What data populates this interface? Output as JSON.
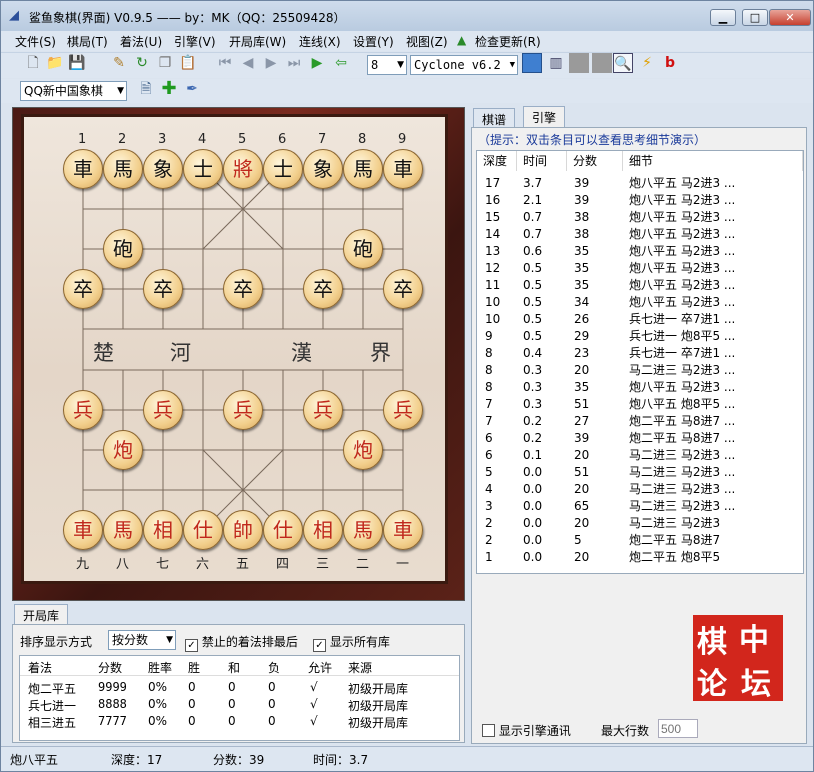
{
  "window": {
    "title": "鲨鱼象棋(界面) V0.9.5  —— by：MK（QQ：25509428）",
    "min": "▁",
    "max": "□",
    "close": "✕"
  },
  "menu": [
    "文件(S)",
    "棋局(T)",
    "着法(U)",
    "引擎(V)",
    "开局库(W)",
    "连线(X)",
    "设置(Y)",
    "视图(Z)",
    "检查更新(R)"
  ],
  "toolbar": {
    "depth_value": "8",
    "engine_value": "Cyclone v6.2",
    "library_value": "QQ新中国象棋"
  },
  "board": {
    "top_files": [
      "1",
      "2",
      "3",
      "4",
      "5",
      "6",
      "7",
      "8",
      "9"
    ],
    "bottom_files": [
      "九",
      "八",
      "七",
      "六",
      "五",
      "四",
      "三",
      "二",
      "一"
    ],
    "river": [
      "楚",
      "河",
      "漢",
      "界"
    ],
    "pieces": [
      "車",
      "馬",
      "象",
      "士",
      "將",
      "士",
      "象",
      "馬",
      "車",
      "砲",
      "砲",
      "卒",
      "卒",
      "卒",
      "卒",
      "卒",
      "兵",
      "兵",
      "兵",
      "兵",
      "兵",
      "炮",
      "炮",
      "車",
      "馬",
      "相",
      "仕",
      "帥",
      "仕",
      "相",
      "馬",
      "車"
    ]
  },
  "opening": {
    "tab": "开局库",
    "sort_label": "排序显示方式",
    "sort_value": "按分数",
    "forbid_label": "禁止的着法排最后",
    "show_all_label": "显示所有库",
    "columns": [
      "着法",
      "分数",
      "胜率",
      "胜",
      "和",
      "负",
      "允许",
      "来源"
    ],
    "rows": [
      [
        "炮二平五",
        "9999",
        "0%",
        "0",
        "0",
        "0",
        "√",
        "初级开局库"
      ],
      [
        "兵七进一",
        "8888",
        "0%",
        "0",
        "0",
        "0",
        "√",
        "初级开局库"
      ],
      [
        "相三进五",
        "7777",
        "0%",
        "0",
        "0",
        "0",
        "√",
        "初级开局库"
      ]
    ]
  },
  "engine": {
    "tabs": [
      "棋谱",
      "引擎"
    ],
    "hint": "（提示：双击条目可以查看思考细节演示）",
    "columns": [
      "深度",
      "时间",
      "分数",
      "细节"
    ],
    "rows": [
      [
        "17",
        "3.7",
        "39",
        "炮八平五 马2进3 ..."
      ],
      [
        "16",
        "2.1",
        "39",
        "炮八平五 马2进3 ..."
      ],
      [
        "15",
        "0.7",
        "38",
        "炮八平五 马2进3 ..."
      ],
      [
        "14",
        "0.7",
        "38",
        "炮八平五 马2进3 ..."
      ],
      [
        "13",
        "0.6",
        "35",
        "炮八平五 马2进3 ..."
      ],
      [
        "12",
        "0.5",
        "35",
        "炮八平五 马2进3 ..."
      ],
      [
        "11",
        "0.5",
        "35",
        "炮八平五 马2进3 ..."
      ],
      [
        "10",
        "0.5",
        "34",
        "炮八平五 马2进3 ..."
      ],
      [
        "10",
        "0.5",
        "26",
        "兵七进一 卒7进1 ..."
      ],
      [
        "9",
        "0.5",
        "29",
        "兵七进一 炮8平5 ..."
      ],
      [
        "8",
        "0.4",
        "23",
        "兵七进一 卒7进1 ..."
      ],
      [
        "8",
        "0.3",
        "20",
        "马二进三 马2进3 ..."
      ],
      [
        "8",
        "0.3",
        "35",
        "炮八平五 马2进3 ..."
      ],
      [
        "7",
        "0.3",
        "51",
        "炮八平五 炮8平5 ..."
      ],
      [
        "7",
        "0.2",
        "27",
        "炮二平五 马8进7 ..."
      ],
      [
        "6",
        "0.2",
        "39",
        "炮二平五 马8进7 ..."
      ],
      [
        "6",
        "0.1",
        "20",
        "马二进三 马2进3 ..."
      ],
      [
        "5",
        "0.0",
        "51",
        "马二进三 马2进3 ..."
      ],
      [
        "4",
        "0.0",
        "20",
        "马二进三 马2进3 ..."
      ],
      [
        "3",
        "0.0",
        "65",
        "马二进三 马2进3 ..."
      ],
      [
        "2",
        "0.0",
        "20",
        "马二进三 马2进3"
      ],
      [
        "2",
        "0.0",
        "5",
        "炮二平五 马8进7"
      ],
      [
        "1",
        "0.0",
        "20",
        "炮二平五 炮8平5"
      ]
    ],
    "show_comm_label": "显示引擎通讯",
    "max_rows_label": "最大行数",
    "max_rows_placeholder": "500",
    "seal": [
      "棋",
      "中",
      "论",
      "坛"
    ]
  },
  "status": {
    "move": "炮八平五",
    "depth": "深度：17",
    "score": "分数：39",
    "time": "时间：3.7"
  }
}
